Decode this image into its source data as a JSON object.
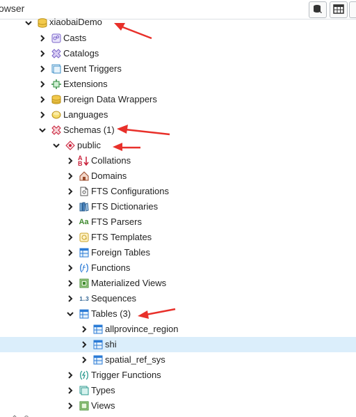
{
  "header": {
    "title": "owser"
  },
  "tree": {
    "database": {
      "label": "xiaobaiDemo"
    },
    "items": {
      "casts": "Casts",
      "catalogs": "Catalogs",
      "event_triggers": "Event Triggers",
      "extensions": "Extensions",
      "fdw": "Foreign Data Wrappers",
      "languages": "Languages",
      "schemas": "Schemas (1)",
      "public": "public",
      "collations": "Collations",
      "domains": "Domains",
      "fts_configurations": "FTS Configurations",
      "fts_dictionaries": "FTS Dictionaries",
      "fts_parsers": "FTS Parsers",
      "fts_templates": "FTS Templates",
      "foreign_tables": "Foreign Tables",
      "functions": "Functions",
      "materialized_views": "Materialized Views",
      "sequences": "Sequences",
      "tables": "Tables (3)",
      "allprovince_region": "allprovince_region",
      "shi": "shi",
      "spatial_ref_sys": "spatial_ref_sys",
      "trigger_functions": "Trigger Functions",
      "types": "Types",
      "views": "Views"
    },
    "icon_text": {
      "fts_parsers": "Aa",
      "sequences": "1..3",
      "collations_a": "A",
      "collations_b": "B"
    }
  },
  "colors": {
    "selected_row": "#dbeefb",
    "annotation_arrow": "#e8302a",
    "table_icon": "#2b7bd6",
    "schema_icon": "#c9203a"
  }
}
